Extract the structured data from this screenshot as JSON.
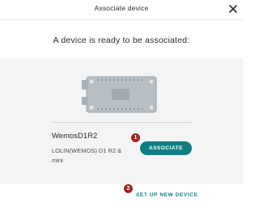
{
  "dialog": {
    "title": "Associate device",
    "close_icon": "close-icon"
  },
  "headline": "A device is ready to be associated:",
  "device": {
    "image_icon": "board-icon",
    "name": "WemosD1R2",
    "description": "LOLIN(WEMOS) D1 R2 & mini"
  },
  "actions": {
    "associate_label": "ASSOCIATE",
    "setup_label": "SET UP NEW DEVICE"
  },
  "annotations": {
    "badge_1": "1",
    "badge_2": "2"
  },
  "colors": {
    "accent": "#0f7f84",
    "badge": "#a4241c",
    "panel": "#f3f4f5"
  }
}
